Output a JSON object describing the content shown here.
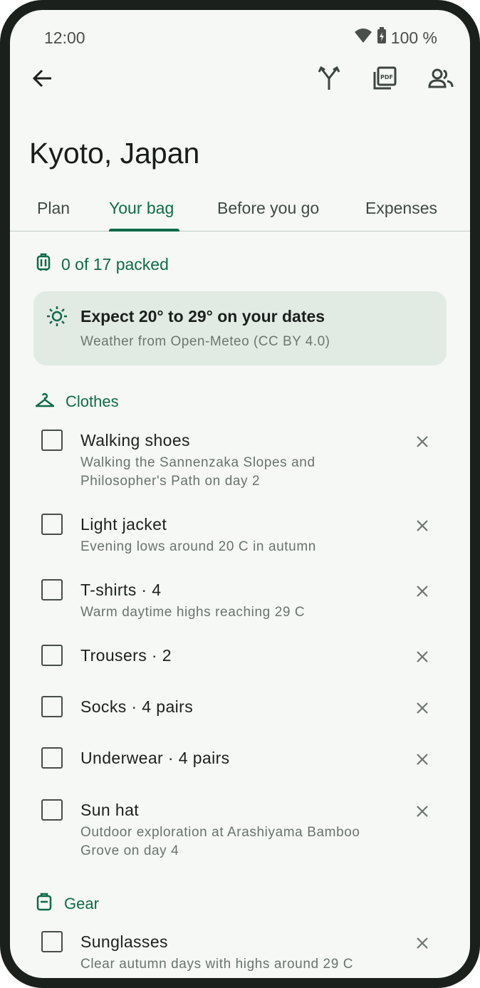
{
  "status_bar": {
    "time": "12:00",
    "battery": "100 %",
    "icons": [
      "wifi-icon",
      "battery-charging-icon"
    ]
  },
  "top_bar": {
    "icons": [
      "arrow-back-icon",
      "fork-icon",
      "pdf-icon",
      "people-icon"
    ]
  },
  "trip": {
    "title": "Kyoto, Japan"
  },
  "tabs": [
    {
      "label": "Plan",
      "active": false
    },
    {
      "label": "Your bag",
      "active": true
    },
    {
      "label": "Before you go",
      "active": false
    },
    {
      "label": "Expenses",
      "active": false
    }
  ],
  "bag": {
    "packed_summary": "0 of 17 packed",
    "weather": {
      "title": "Expect 20° to 29° on your dates",
      "source": "Weather from Open-Meteo (CC BY 4.0)"
    }
  },
  "sections": [
    {
      "name": "Clothes",
      "icon": "hanger-icon",
      "items": [
        {
          "name": "Walking shoes",
          "note": "Walking the Sannenzaka Slopes and Philosopher's Path on day 2",
          "checked": false
        },
        {
          "name": "Light jacket",
          "note": "Evening lows around 20 C in autumn",
          "checked": false
        },
        {
          "name": "T-shirts · 4",
          "note": "Warm daytime highs reaching 29 C",
          "checked": false
        },
        {
          "name": "Trousers · 2",
          "note": "",
          "checked": false
        },
        {
          "name": "Socks · 4 pairs",
          "note": "",
          "checked": false
        },
        {
          "name": "Underwear · 4 pairs",
          "note": "",
          "checked": false
        },
        {
          "name": "Sun hat",
          "note": "Outdoor exploration at Arashiyama Bamboo Grove on day 4",
          "checked": false
        }
      ]
    },
    {
      "name": "Gear",
      "icon": "gear-bag-icon",
      "items": [
        {
          "name": "Sunglasses",
          "note": "Clear autumn days with highs around 29 C",
          "checked": false
        }
      ]
    }
  ],
  "colors": {
    "accent": "#0f6a4a",
    "background": "#f5f8f4",
    "card": "#e2eae4",
    "frame": "#1b201c"
  }
}
